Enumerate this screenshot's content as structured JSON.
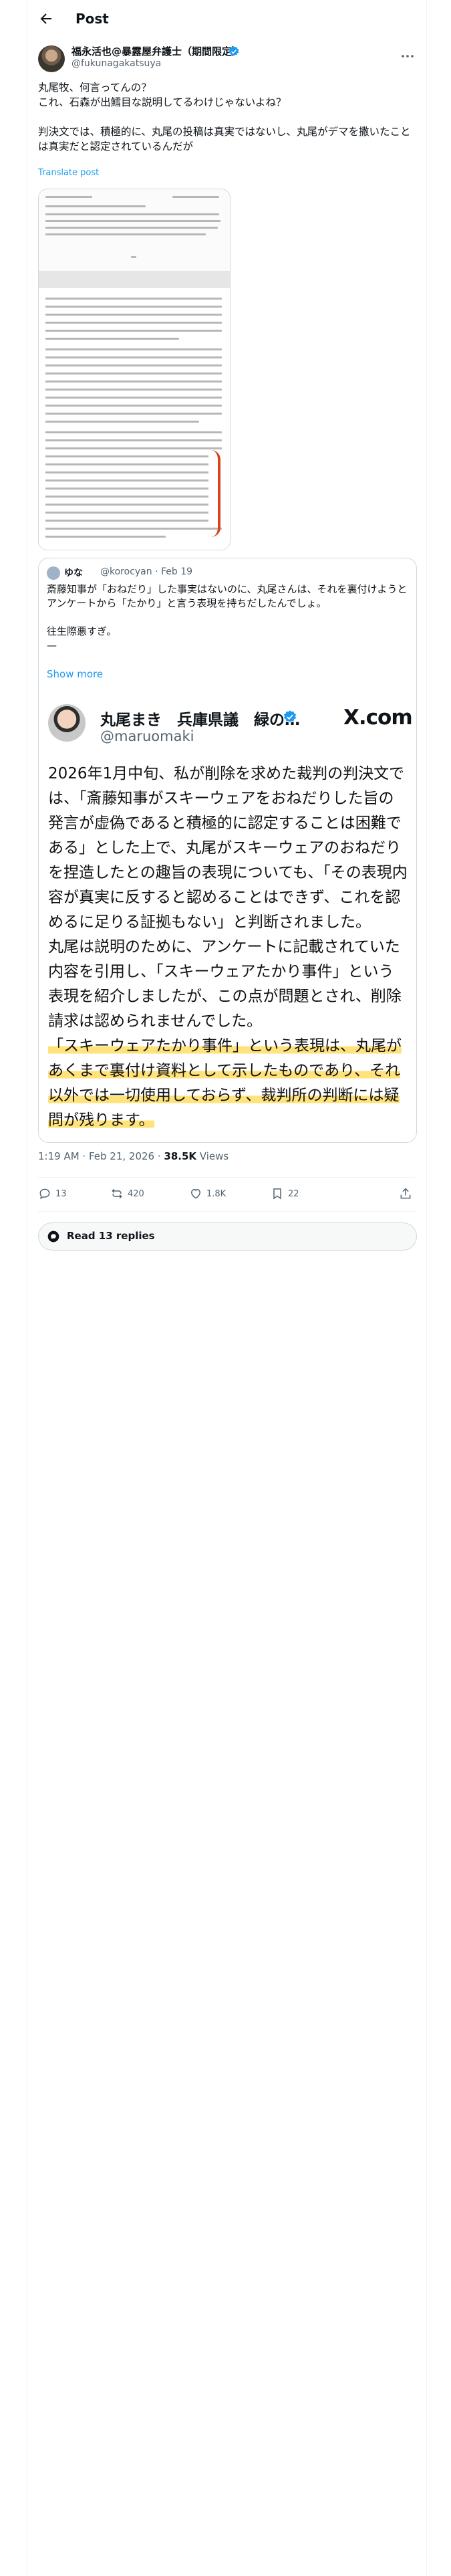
{
  "header": {
    "title": "Post"
  },
  "post": {
    "author_name": "福永活也@暴露屋弁護士（期間限定）",
    "author_handle": "@fukunagakatsuya",
    "text": "丸尾牧、何言ってんの？\nこれ、石森が出鱈目な説明してるわけじゃないよね？\n\n判決文では、積極的に、丸尾の投稿は真実ではないし、丸尾がデマを撒いたことは真実だと認定されているんだが",
    "translate_label": "Translate post",
    "timestamp": "1:19 AM · Feb 21, 2026 · ",
    "views_count": "38.5K",
    "views_label": " Views"
  },
  "quote": {
    "author_name": "ゆな",
    "meta": "@korocyan · Feb 19",
    "text": "斎藤知事が「おねだり」した事実はないのに、丸尾さんは、それを裏付けようとアンケートから「たかり」と言う表現を持ちだしたんでしょ。\n\n往生際悪すぎ。\n—",
    "show_more": "Show more",
    "image": {
      "author_name": "丸尾まき　兵庫県議　緑の…",
      "author_handle": "@maruomaki",
      "brand": "X.com",
      "paragraphs": [
        "2026年1月中旬、私が削除を求めた裁判の判決文では、「斎藤知事がスキーウェアをおねだりした旨の発言が虚偽であると積極的に認定することは困難である」とした上で、丸尾がスキーウェアのおねだりを捏造したとの趣旨の表現についても、「その表現内容が真実に反すると認めることはできず、これを認めるに足りる証拠もない」と判断されました。",
        "丸尾は説明のために、アンケートに記載されていた内容を引用し、「スキーウェアたかり事件」という表現を紹介しましたが、この点が問題とされ、削除請求は認められませんでした。"
      ],
      "highlight": "「スキーウェアたかり事件」という表現は、丸尾があくまで裏付け資料として示したものであり、それ以外では一切使用しておらず、裁判所の判断には疑問が残ります。"
    }
  },
  "actions": {
    "replies": "13",
    "reposts": "420",
    "likes": "1.8K",
    "bookmarks": "22"
  },
  "read_replies": "Read 13 replies",
  "colors": {
    "link": "#1d9bf0",
    "verified": "#1d9bf0",
    "muted": "#536471",
    "highlight": "#ffe27a",
    "annotation_red": "#d8421f"
  }
}
